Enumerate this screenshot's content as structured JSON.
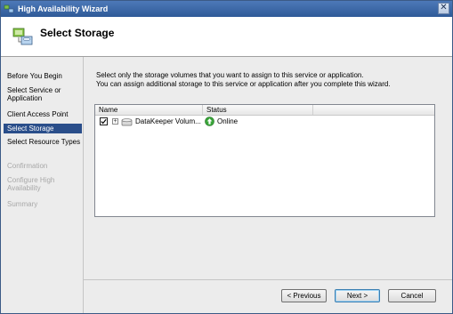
{
  "window": {
    "title": "High Availability Wizard",
    "close_glyph": "✕"
  },
  "header": {
    "page_title": "Select Storage",
    "icon": "storage-wizard-icon"
  },
  "sidebar": {
    "items": [
      {
        "label": "Before You Begin",
        "state": "normal"
      },
      {
        "label": "Select Service or Application",
        "state": "normal"
      },
      {
        "label": "Client Access Point",
        "state": "normal"
      },
      {
        "label": "Select Storage",
        "state": "active"
      },
      {
        "label": "Select Resource Types",
        "state": "normal"
      },
      {
        "label": "Confirmation",
        "state": "disabled"
      },
      {
        "label": "Configure High Availability",
        "state": "disabled"
      },
      {
        "label": "Summary",
        "state": "disabled"
      }
    ]
  },
  "main": {
    "instructions_line1": "Select only the storage volumes that you want to assign to this service or application.",
    "instructions_line2": "You can assign additional storage to this service or application after you complete this wizard.",
    "list": {
      "columns": [
        "Name",
        "Status"
      ],
      "rows": [
        {
          "checked": true,
          "name": "DataKeeper Volum...",
          "status": "Online",
          "status_icon": "online-up-arrow-icon"
        }
      ]
    }
  },
  "buttons": {
    "previous": "< Previous",
    "next": "Next >",
    "cancel": "Cancel"
  },
  "colors": {
    "title_bar": "#2f5a98",
    "active_nav": "#2a4e8a",
    "panel_bg": "#ececec",
    "online_green": "#3aa53a"
  }
}
